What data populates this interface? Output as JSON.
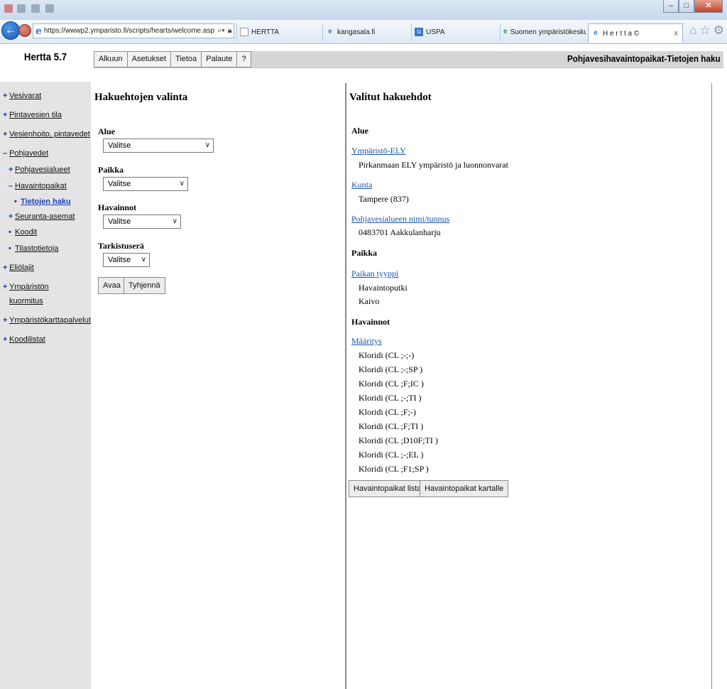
{
  "browser": {
    "address": "https://wwwp2.ymparisto.fi/scripts/hearts/welcome.asp",
    "tabs": [
      {
        "label": "HERTTA"
      },
      {
        "label": "kangasala.fi"
      },
      {
        "label": "USPA"
      },
      {
        "label": "Suomen ympäristökeskus > ..."
      },
      {
        "label": "H e r t t a ©"
      }
    ],
    "close_tab_glyph": "x"
  },
  "app": {
    "title": "Hertta 5.7",
    "page_heading": "Pohjavesihavaintopaikat-Tietojen haku",
    "menu": [
      "Alkuun",
      "Asetukset",
      "Tietoa",
      "Palaute",
      "?"
    ]
  },
  "sidebar": {
    "items": [
      {
        "mark": "+",
        "label": "Vesivarat"
      },
      {
        "mark": "+",
        "label": "Pintavesien tila"
      },
      {
        "mark": "+",
        "label": "Vesienhoito, pintavedet"
      },
      {
        "mark": "–",
        "label": "Pohjavedet"
      },
      {
        "mark": "+",
        "label": "Pohjavesialueet"
      },
      {
        "mark": "–",
        "label": "Havaintopaikat"
      },
      {
        "mark": "•",
        "label": "Tietojen haku"
      },
      {
        "mark": "+",
        "label": "Seuranta-asemat"
      },
      {
        "mark": "•",
        "label": "Koodit"
      },
      {
        "mark": "•",
        "label": "Tilastotietoja"
      },
      {
        "mark": "+",
        "label": "Eliölajit"
      },
      {
        "mark": "+",
        "label": "Ympäristön"
      },
      {
        "mark": "",
        "label": "kuormitus"
      },
      {
        "mark": "+",
        "label": "Ympäristökarttapalvelut"
      },
      {
        "mark": "+",
        "label": "Koodilistat"
      }
    ]
  },
  "search": {
    "heading": "Hakuehtojen valinta",
    "fields": [
      {
        "label": "Alue",
        "value": "Valitse"
      },
      {
        "label": "Paikka",
        "value": "Valitse"
      },
      {
        "label": "Havainnot",
        "value": "Valitse"
      },
      {
        "label": "Tarkistuserä",
        "value": "Valitse"
      }
    ],
    "open_label": "Avaa",
    "clear_label": "Tyhjennä"
  },
  "selected": {
    "heading": "Valitut hakuehdot",
    "area_title": "Alue",
    "ely_link": "Ympäristö-ELY",
    "ely_value": "Pirkanmaan ELY ympäristö ja luonnonvarat",
    "municipality_link": "Kunta",
    "municipality_value": "Tampere (837)",
    "gw_area_link": "Pohjavesialueen nimi/tunnus",
    "gw_area_value": "0483701 Aakkulanharju",
    "place_title": "Paikka",
    "place_type_link": "Paikan tyyppi",
    "place_types": [
      "Havaintoputki",
      "Kaivo"
    ],
    "obs_title": "Havainnot",
    "determination_link": "Määritys",
    "determinations": [
      "Kloridi (CL ;-;-)",
      "Kloridi (CL ;-;SP )",
      "Kloridi (CL ;F;IC )",
      "Kloridi (CL ;-;TI )",
      "Kloridi (CL ;F;-)",
      "Kloridi (CL ;F;TI )",
      "Kloridi (CL ;D10F;TI )",
      "Kloridi (CL ;-;EL )",
      "Kloridi (CL ;F1;SP )"
    ],
    "list_button": "Havaintopaikat listana",
    "map_button": "Havaintopaikat kartalle"
  }
}
